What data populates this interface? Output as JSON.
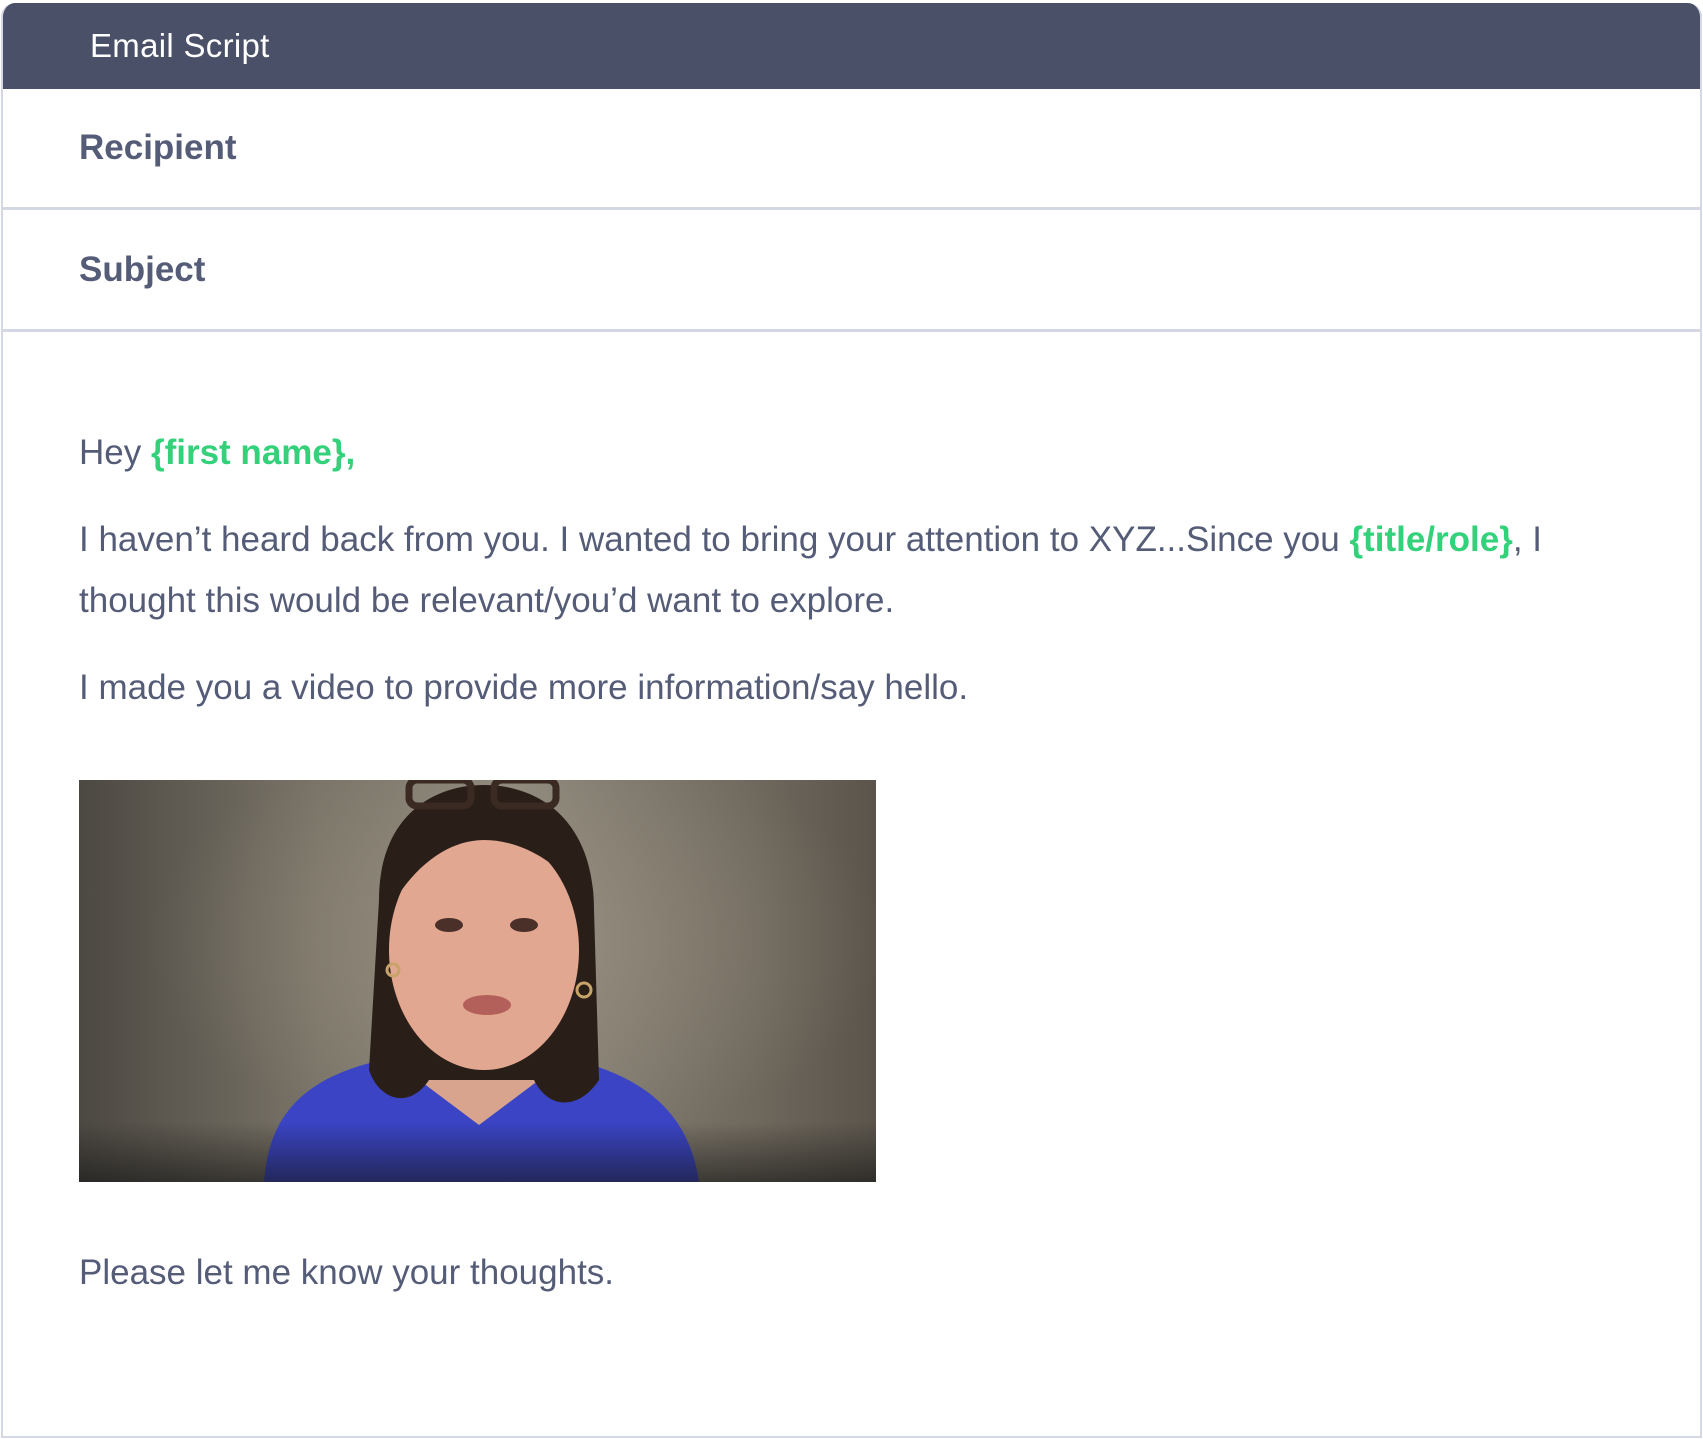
{
  "header": {
    "title": "Email Script"
  },
  "fields": {
    "recipient_label": "Recipient",
    "subject_label": "Subject"
  },
  "email": {
    "greeting_prefix": "Hey ",
    "greeting_variable": "{first name}",
    "greeting_suffix": ",",
    "main_text_1": "I haven’t heard back from you. I wanted to bring your attention to XYZ...Since you ",
    "main_variable": "{title/role}",
    "main_text_2": ", I thought this would be relevant/you’d want to explore.",
    "video_intro": "I made you a video to provide more information/say hello.",
    "closing": "Please let me know your thoughts."
  },
  "colors": {
    "header_bg": "#4a5068",
    "text": "#555c77",
    "variable": "#33d17a",
    "border": "#d3d8e4"
  }
}
